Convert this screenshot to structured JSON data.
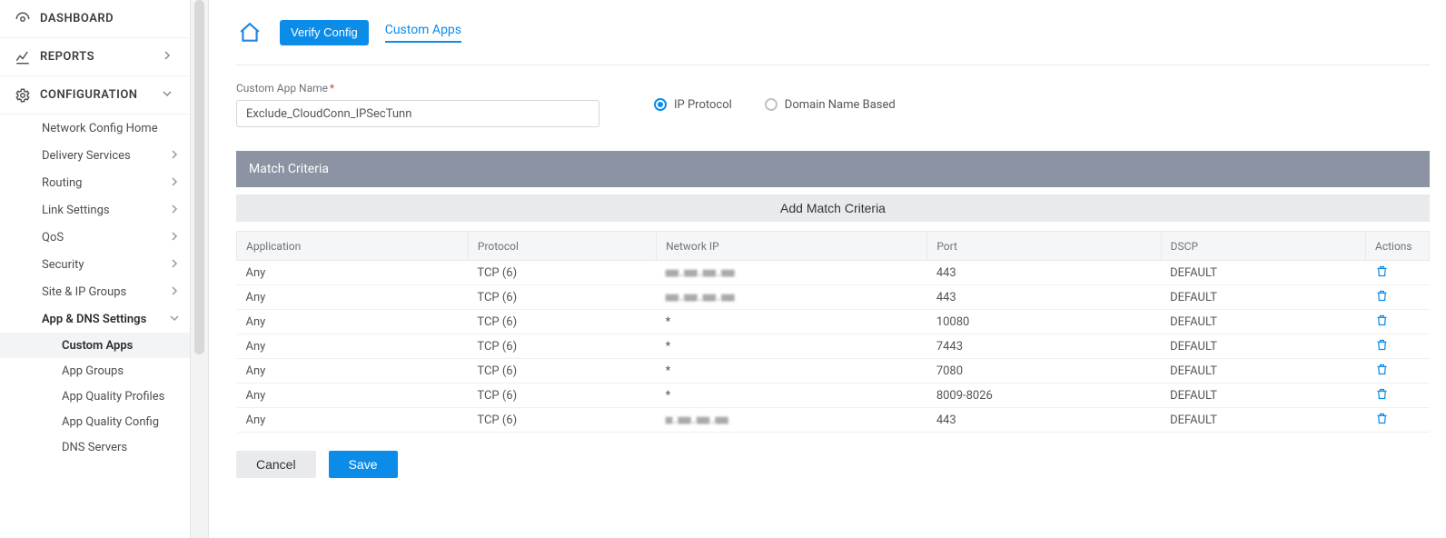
{
  "nav": {
    "dashboard": "DASHBOARD",
    "reports": "REPORTS",
    "configuration": "CONFIGURATION",
    "children": [
      {
        "label": "Network Config Home"
      },
      {
        "label": "Delivery Services"
      },
      {
        "label": "Routing"
      },
      {
        "label": "Link Settings"
      },
      {
        "label": "QoS"
      },
      {
        "label": "Security"
      },
      {
        "label": "Site & IP Groups"
      },
      {
        "label": "App & DNS Settings"
      }
    ],
    "subsubs": [
      "Custom Apps",
      "App Groups",
      "App Quality Profiles",
      "App Quality Config",
      "DNS Servers"
    ]
  },
  "breadcrumb": {
    "verify": "Verify Config",
    "active": "Custom Apps"
  },
  "form": {
    "name_label": "Custom App Name",
    "name_value": "Exclude_CloudConn_IPSecTunn",
    "radio_ip": "IP Protocol",
    "radio_domain": "Domain Name Based"
  },
  "section": {
    "title": "Match Criteria",
    "add": "Add Match Criteria"
  },
  "table": {
    "headers": [
      "Application",
      "Protocol",
      "Network IP",
      "Port",
      "DSCP",
      "Actions"
    ],
    "rows": [
      {
        "app": "Any",
        "proto": "TCP (6)",
        "ip": "■■.■■.■■.■■",
        "port": "443",
        "dscp": "DEFAULT"
      },
      {
        "app": "Any",
        "proto": "TCP (6)",
        "ip": "■■.■■.■■.■■",
        "port": "443",
        "dscp": "DEFAULT"
      },
      {
        "app": "Any",
        "proto": "TCP (6)",
        "ip": "*",
        "port": "10080",
        "dscp": "DEFAULT"
      },
      {
        "app": "Any",
        "proto": "TCP (6)",
        "ip": "*",
        "port": "7443",
        "dscp": "DEFAULT"
      },
      {
        "app": "Any",
        "proto": "TCP (6)",
        "ip": "*",
        "port": "7080",
        "dscp": "DEFAULT"
      },
      {
        "app": "Any",
        "proto": "TCP (6)",
        "ip": "*",
        "port": "8009-8026",
        "dscp": "DEFAULT"
      },
      {
        "app": "Any",
        "proto": "TCP (6)",
        "ip": "■.■■.■■.■■",
        "port": "443",
        "dscp": "DEFAULT"
      }
    ]
  },
  "buttons": {
    "cancel": "Cancel",
    "save": "Save"
  }
}
